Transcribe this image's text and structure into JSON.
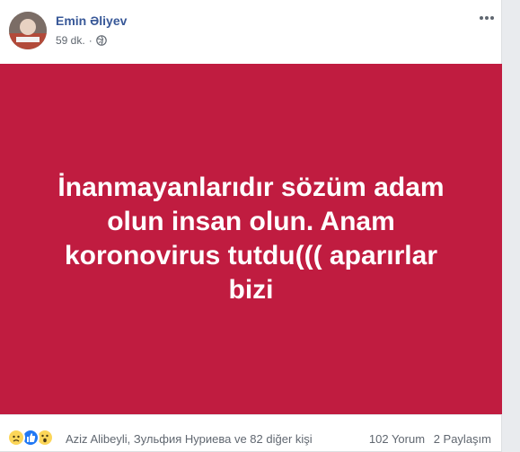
{
  "post": {
    "author": "Emin Əliyev",
    "time": "59 dk.",
    "separator": "·",
    "privacy_icon": "globe-icon",
    "more_icon": "more-horizontal-icon",
    "status_text": "İnanmayanlarıdır sözüm adam olun insan olun. Anam koronovirus tutdu((( aparırlar bizi",
    "background_color": "#c01c40"
  },
  "footer": {
    "reaction_icons": [
      "sad-reaction-icon",
      "like-reaction-icon",
      "wow-reaction-icon"
    ],
    "reaction_names": "Aziz Alibeyli, Зульфия Нуриева ve 82 diğer kişi",
    "comments": "102 Yorum",
    "shares": "2 Paylaşım"
  },
  "colors": {
    "author_link": "#385898",
    "post_background": "#c01c40",
    "like_blue": "#2078f4",
    "emoji_yellow": "#fcd659"
  }
}
